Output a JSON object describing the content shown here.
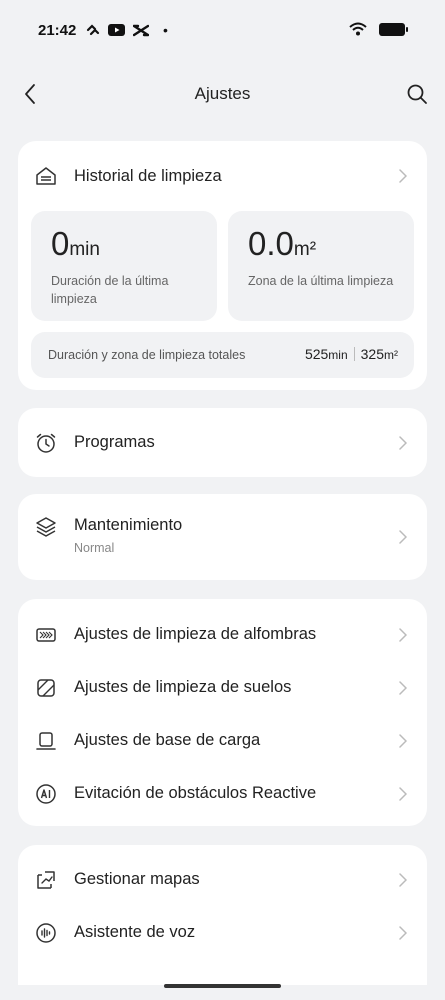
{
  "status_bar": {
    "time": "21:42",
    "dot": "•"
  },
  "header": {
    "title": "Ajustes"
  },
  "history": {
    "title": "Historial de limpieza",
    "last_duration": {
      "value": "0",
      "unit": "min",
      "label": "Duración de la última limpieza"
    },
    "last_area": {
      "value": "0.0",
      "unit": "m²",
      "label": "Zona de la última limpieza"
    },
    "totals": {
      "label": "Duración y zona de limpieza totales",
      "duration_value": "525",
      "duration_unit": "min",
      "area_value": "325",
      "area_unit": "m²"
    }
  },
  "programs": {
    "label": "Programas"
  },
  "maintenance": {
    "label": "Mantenimiento",
    "status": "Normal"
  },
  "cleaning_settings": {
    "items": [
      {
        "label": "Ajustes de limpieza de alfombras",
        "icon": "carpet-icon"
      },
      {
        "label": "Ajustes de limpieza de suelos",
        "icon": "floor-icon"
      },
      {
        "label": "Ajustes de base de carga",
        "icon": "dock-icon"
      },
      {
        "label": "Evitación de obstáculos Reactive",
        "icon": "ai-icon"
      }
    ]
  },
  "maps_voice": {
    "items": [
      {
        "label": "Gestionar mapas",
        "icon": "map-icon"
      },
      {
        "label": "Asistente de voz",
        "icon": "voice-icon"
      }
    ]
  },
  "colors": {
    "background": "#f1f2f4",
    "card": "#ffffff",
    "text": "#222222",
    "muted": "#888888"
  }
}
